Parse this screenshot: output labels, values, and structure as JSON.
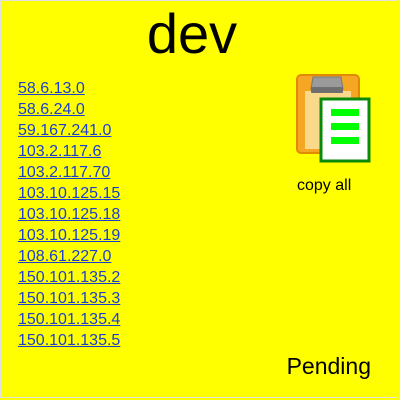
{
  "header": {
    "title": "dev"
  },
  "ips": [
    "58.6.13.0",
    "58.6.24.0",
    "59.167.241.0",
    "103.2.117.6",
    "103.2.117.70",
    "103.10.125.15",
    "103.10.125.18",
    "103.10.125.19",
    "108.61.227.0",
    "150.101.135.2",
    "150.101.135.3",
    "150.101.135.4",
    "150.101.135.5"
  ],
  "copy": {
    "label": "copy all",
    "icon": "clipboard-icon"
  },
  "status": {
    "text": "Pending"
  },
  "colors": {
    "background": "#ffff00",
    "link": "#1a3fd0",
    "clipboard_board": "#f5a623",
    "clipboard_clip": "#9a9a9a",
    "doc_border": "#0a8a0a",
    "doc_lines": "#00ff00"
  }
}
